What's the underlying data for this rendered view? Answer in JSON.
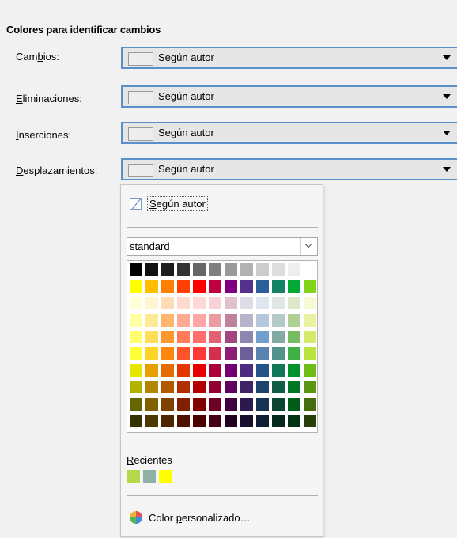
{
  "section_title": "Colores para identificar cambios",
  "rows": [
    {
      "label_pre": "Cam",
      "label_mn": "b",
      "label_post": "ios:",
      "value": "Según autor"
    },
    {
      "label_pre": "",
      "label_mn": "E",
      "label_post": "liminaciones:",
      "value": "Según autor"
    },
    {
      "label_pre": "",
      "label_mn": "I",
      "label_post": "nserciones:",
      "value": "Según autor"
    },
    {
      "label_pre": "",
      "label_mn": "D",
      "label_post": "esplazamientos:",
      "value": "Según autor"
    }
  ],
  "popup": {
    "auto_pre": "",
    "auto_mn": "S",
    "auto_post": "egún autor",
    "palette": "standard",
    "recent_pre": "",
    "recent_mn": "R",
    "recent_post": "ecientes",
    "custom_pre": "Color ",
    "custom_mn": "p",
    "custom_post": "ersonalizado…"
  },
  "palette_colors": [
    [
      "#000000",
      "#111111",
      "#1c1c1c",
      "#333333",
      "#666666",
      "#808080",
      "#999999",
      "#b2b2b2",
      "#cccccc",
      "#dddddd",
      "#eeeeee",
      "#ffffff"
    ],
    [
      "#ffff00",
      "#ffbf00",
      "#ff8000",
      "#ff4000",
      "#ff0000",
      "#bf0041",
      "#800080",
      "#55308d",
      "#2a6099",
      "#158466",
      "#00a933",
      "#81d41a"
    ],
    [
      "#ffffd7",
      "#fff5ce",
      "#ffdbb6",
      "#ffd8ce",
      "#ffd7d7",
      "#f7d1d5",
      "#e0c2cd",
      "#dedce6",
      "#dee6ef",
      "#dee7e5",
      "#dde8cb",
      "#f6f9d4"
    ],
    [
      "#ffffa6",
      "#ffe994",
      "#ffb66c",
      "#ffaa95",
      "#ffa6a6",
      "#ec9ba4",
      "#bf819e",
      "#b7b3ca",
      "#b4c7dc",
      "#b3cac7",
      "#afd095",
      "#e8f2a1"
    ],
    [
      "#ffff6d",
      "#ffde59",
      "#ff972f",
      "#ff7b59",
      "#ff6d6d",
      "#e16173",
      "#a1467e",
      "#8e86ae",
      "#729fcf",
      "#81aca6",
      "#77bc65",
      "#d4ea6b"
    ],
    [
      "#ffff38",
      "#ffd428",
      "#ff860d",
      "#ff5429",
      "#ff3838",
      "#d62e4e",
      "#8d1d75",
      "#6b5e9b",
      "#5983b0",
      "#50938a",
      "#3faf46",
      "#bbe33d"
    ],
    [
      "#e6e600",
      "#e6a000",
      "#e66b00",
      "#e63600",
      "#e60000",
      "#ad0039",
      "#730073",
      "#4d2b80",
      "#255387",
      "#127659",
      "#00912c",
      "#70bb16"
    ],
    [
      "#b2b200",
      "#b28600",
      "#b25900",
      "#b22d00",
      "#b20000",
      "#900030",
      "#5e005e",
      "#3e2367",
      "#1d436c",
      "#0f5d46",
      "#007723",
      "#5a9612"
    ],
    [
      "#666600",
      "#806000",
      "#804000",
      "#802000",
      "#800000",
      "#6b0022",
      "#400040",
      "#2c1a4d",
      "#153252",
      "#0a4433",
      "#005c19",
      "#436d0e"
    ],
    [
      "#333300",
      "#4d3800",
      "#4d2600",
      "#4d1300",
      "#4d0000",
      "#46001a",
      "#220022",
      "#1b0f2e",
      "#0e1f33",
      "#06281f",
      "#003310",
      "#273f08"
    ]
  ],
  "recent_colors": [
    "#b4d94a",
    "#8fb0a6",
    "#ffff00"
  ],
  "custom_icon_colors": [
    "#e15653",
    "#3d8fd6",
    "#58b455",
    "#f0b532"
  ]
}
